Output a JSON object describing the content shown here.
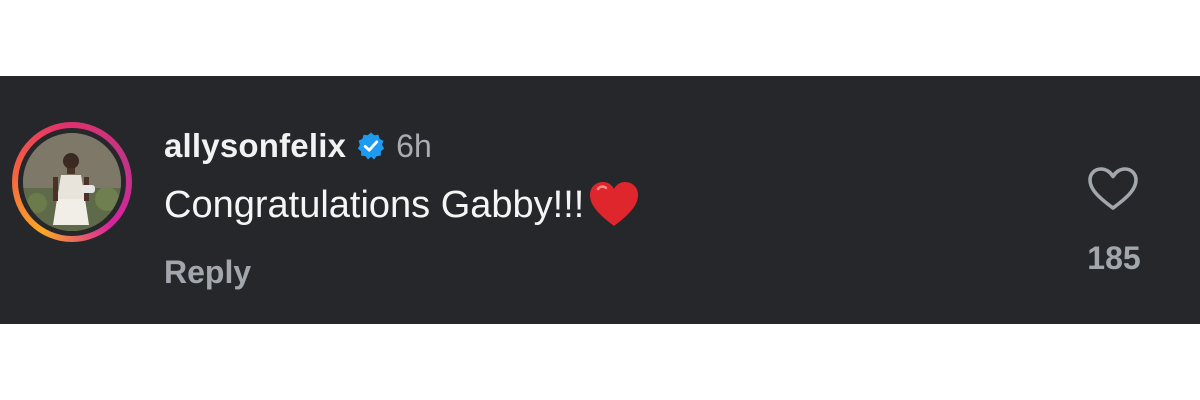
{
  "comment": {
    "username": "allysonfelix",
    "verified_icon": "verified-badge-icon",
    "timestamp": "6h",
    "text": "Congratulations Gabby!!!",
    "emoji": "red-heart",
    "reply_label": "Reply",
    "like_icon": "heart-outline-icon",
    "like_count": "185"
  },
  "colors": {
    "card_background": "#25272b",
    "verified_blue": "#1d9bf0",
    "muted_text": "#a2a6ad",
    "primary_text": "#f5f5f5",
    "heart_red": "#e0262d"
  }
}
